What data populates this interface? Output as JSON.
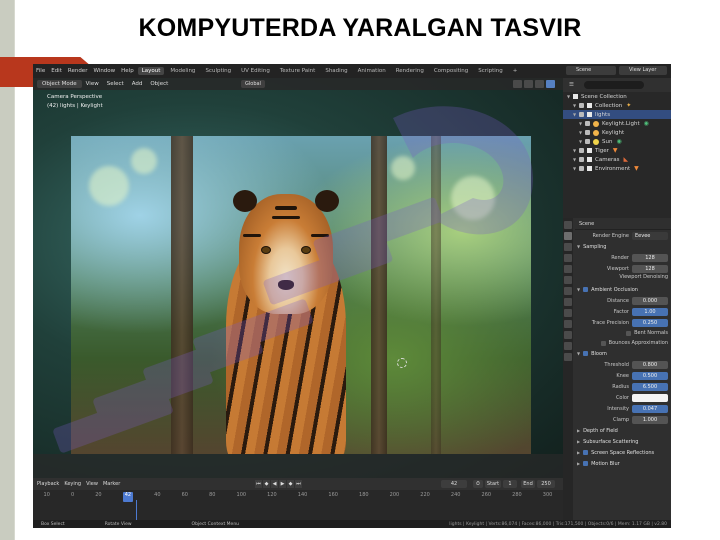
{
  "slide": {
    "title": "KOMPYUTERDA YARALGAN TASVIR"
  },
  "topbar": {
    "menu": [
      "File",
      "Edit",
      "Render",
      "Window",
      "Help"
    ],
    "workspaces": [
      "Layout",
      "Modeling",
      "Sculpting",
      "UV Editing",
      "Texture Paint",
      "Shading",
      "Animation",
      "Rendering",
      "Compositing",
      "Scripting"
    ],
    "active_workspace": "Layout",
    "add_tab": "+",
    "scene": "Scene",
    "view_layer": "View Layer"
  },
  "viewport": {
    "mode": "Object Mode",
    "menu": [
      "View",
      "Select",
      "Add",
      "Object"
    ],
    "transform": "Global",
    "overlay_line1": "Camera Perspective",
    "overlay_line2": "(42) lights | Keylight"
  },
  "timeline": {
    "menu": [
      "Playback",
      "Keying",
      "View",
      "Marker"
    ],
    "current_frame": "42",
    "start_label": "Start",
    "start_value": "1",
    "end_label": "End",
    "end_value": "250",
    "ruler": [
      "10",
      "0",
      "20",
      "40",
      "60",
      "80",
      "100",
      "120",
      "140",
      "160",
      "180",
      "200",
      "220",
      "240",
      "260",
      "280",
      "300"
    ]
  },
  "statusbar": {
    "select": "Box Select",
    "rotate": "Rotate View",
    "context": "Object Context Menu",
    "info": "lights | Keylight | Verts:86,074 | Faces:86,000 | Tris:171,500 | Objects:0/6 | Mem: 1.17 GB | v2.80"
  },
  "outliner": {
    "rows": [
      {
        "label": "Scene Collection",
        "level": 0,
        "icon": "collection-icon",
        "trailing": ""
      },
      {
        "label": "Collection",
        "level": 1,
        "icon": "collection-icon",
        "trailing": "light-icon"
      },
      {
        "label": "lights",
        "level": 1,
        "icon": "collection-icon",
        "trailing": "",
        "selected": true
      },
      {
        "label": "Keylight.Light",
        "level": 2,
        "icon": "light-icon",
        "trailing": "light-data-icon"
      },
      {
        "label": "Keylight",
        "level": 2,
        "icon": "light-icon",
        "trailing": ""
      },
      {
        "label": "Sun",
        "level": 2,
        "icon": "sun-icon",
        "trailing": "light-data-icon"
      },
      {
        "label": "Tiger",
        "level": 1,
        "icon": "collection-icon",
        "trailing": "mesh-icon"
      },
      {
        "label": "Cameras",
        "level": 1,
        "icon": "collection-icon",
        "trailing": "camera-icon"
      },
      {
        "label": "Environment",
        "level": 1,
        "icon": "collection-icon",
        "trailing": "mesh-icon"
      }
    ]
  },
  "properties": {
    "scene_label": "Scene",
    "render_engine_label": "Render Engine",
    "render_engine": "Eevee",
    "sampling": "Sampling",
    "render_label": "Render",
    "render_value": "128",
    "viewport_label": "Viewport",
    "viewport_value": "128",
    "viewport_denoise": "Viewport Denoising",
    "ao": "Ambient Occlusion",
    "distance_label": "Distance",
    "distance_value": "0.000",
    "factor_label": "Factor",
    "factor_value": "1.00",
    "trace_label": "Trace Precision",
    "trace_value": "0.250",
    "bent_normals": "Bent Normals",
    "bounces": "Bounces Approximation",
    "bloom": "Bloom",
    "threshold_label": "Threshold",
    "threshold_value": "0.800",
    "knee_label": "Knee",
    "knee_value": "0.500",
    "radius_label": "Radius",
    "radius_value": "6.500",
    "color_label": "Color",
    "intensity_label": "Intensity",
    "intensity_value": "0.047",
    "clamp_label": "Clamp",
    "clamp_value": "1.000",
    "dof": "Depth of Field",
    "sss": "Subsurface Scattering",
    "ssr": "Screen Space Reflections",
    "motion_blur": "Motion Blur"
  }
}
